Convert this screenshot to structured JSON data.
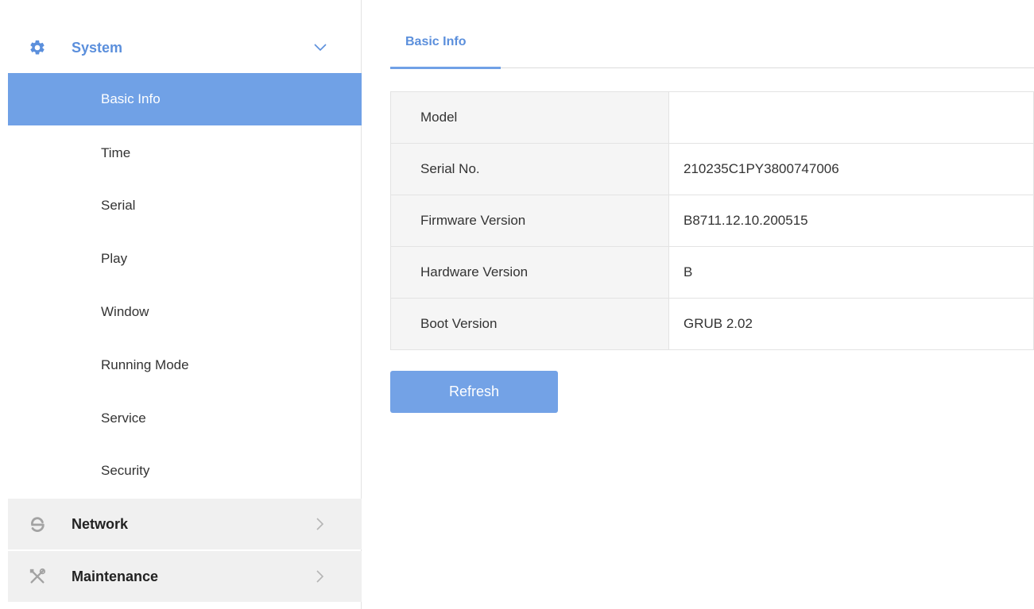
{
  "colors": {
    "accent": "#5b8fdc",
    "active_item_bg": "#70a1e6",
    "button_bg": "#73a2e6",
    "group_bg": "#f0f0f0"
  },
  "sidebar": {
    "system": {
      "label": "System",
      "icon": "gear-icon",
      "arrow": "chevron-down-icon",
      "items": [
        {
          "label": "Basic Info",
          "active": true
        },
        {
          "label": "Time"
        },
        {
          "label": "Serial"
        },
        {
          "label": "Play"
        },
        {
          "label": "Window"
        },
        {
          "label": "Running Mode"
        },
        {
          "label": "Service"
        },
        {
          "label": "Security"
        }
      ]
    },
    "network": {
      "label": "Network",
      "icon": "network-e-icon",
      "arrow": "chevron-right-icon"
    },
    "maintenance": {
      "label": "Maintenance",
      "icon": "tools-icon",
      "arrow": "chevron-right-icon"
    }
  },
  "main": {
    "tabs": [
      {
        "label": "Basic Info",
        "active": true
      }
    ],
    "info_table": {
      "rows": [
        {
          "label": "Model",
          "value": ""
        },
        {
          "label": "Serial No.",
          "value": "210235C1PY3800747006"
        },
        {
          "label": "Firmware Version",
          "value": "B8711.12.10.200515"
        },
        {
          "label": "Hardware Version",
          "value": "B"
        },
        {
          "label": "Boot Version",
          "value": "GRUB 2.02"
        }
      ]
    },
    "refresh_label": "Refresh"
  }
}
